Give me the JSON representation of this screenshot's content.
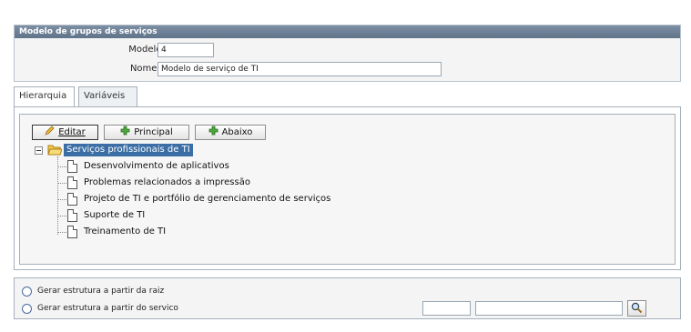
{
  "header": {
    "title": "Modelo de grupos de serviços",
    "modelo_label": "Modelo :",
    "modelo_value": "4",
    "nome_label": "Nome",
    "nome_required": "*",
    "nome_colon": " :",
    "nome_value": "Modelo de serviço de TI"
  },
  "tabs": [
    {
      "label": "Hierarquia",
      "active": true
    },
    {
      "label": "Variáveis",
      "active": false
    }
  ],
  "toolbar": {
    "editar_label": "Editar",
    "principal_label": "Principal",
    "abaixo_label": "Abaixo"
  },
  "tree": {
    "root": "Serviços profissionais de TI",
    "children": [
      "Desenvolvimento de aplicativos",
      "Problemas relacionados a impressão",
      "Projeto de TI e portfólio de gerenciamento de serviços",
      "Suporte de TI",
      "Treinamento de TI"
    ]
  },
  "bottom": {
    "radio_raiz": "Gerar estrutura a partir da raiz",
    "radio_servico": "Gerar estrutura a partir do servico",
    "code_value": "",
    "name_value": ""
  },
  "colors": {
    "header_bar": "#6a7e94",
    "selection": "#3a6ea5",
    "required": "#dd0000"
  }
}
